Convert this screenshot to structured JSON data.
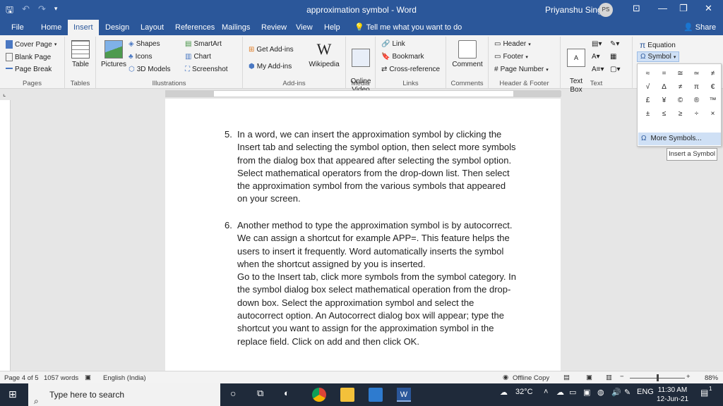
{
  "titlebar": {
    "doc_title": "approximation symbol  -  Word",
    "user_name": "Priyanshu Singh",
    "avatar_initials": "PS"
  },
  "tabs": [
    "File",
    "Home",
    "Insert",
    "Design",
    "Layout",
    "References",
    "Mailings",
    "Review",
    "View",
    "Help"
  ],
  "active_tab": "Insert",
  "tell_me": "Tell me what you want to do",
  "share": "Share",
  "ribbon": {
    "pages": {
      "label": "Pages",
      "cover_page": "Cover Page",
      "blank_page": "Blank Page",
      "page_break": "Page Break"
    },
    "tables": {
      "label": "Tables",
      "table": "Table"
    },
    "illustrations": {
      "label": "Illustrations",
      "pictures": "Pictures",
      "shapes": "Shapes",
      "icons": "Icons",
      "models": "3D Models",
      "smartart": "SmartArt",
      "chart": "Chart",
      "screenshot": "Screenshot"
    },
    "addins": {
      "label": "Add-ins",
      "get": "Get Add-ins",
      "my": "My Add-ins",
      "wikipedia": "Wikipedia"
    },
    "media": {
      "label": "Media",
      "online_video": "Online\nVideo"
    },
    "links": {
      "label": "Links",
      "link": "Link",
      "bookmark": "Bookmark",
      "cross_ref": "Cross-reference"
    },
    "comments": {
      "label": "Comments",
      "comment": "Comment"
    },
    "header_footer": {
      "label": "Header & Footer",
      "header": "Header",
      "footer": "Footer",
      "page_number": "Page Number"
    },
    "text": {
      "label": "Text",
      "text_box": "Text\nBox"
    },
    "symbols": {
      "equation": "Equation",
      "symbol": "Symbol"
    }
  },
  "symbol_panel": {
    "symbols": [
      "≈",
      "=",
      "≅",
      "≃",
      "≠",
      "√",
      "∆",
      "≠",
      "π",
      "€",
      "£",
      "¥",
      "©",
      "®",
      "™",
      "±",
      "≤",
      "≥",
      "÷",
      "×"
    ],
    "more_symbols": "More Symbols...",
    "tooltip": "Insert a Symbol"
  },
  "document": {
    "items": [
      {
        "num": "5.",
        "text": "In a word, we can insert the approximation symbol by clicking the Insert tab and selecting the symbol option, then select more symbols from the dialog box that appeared after selecting the symbol option. Select mathematical operators from the drop-down list. Then select the approximation symbol from the various symbols that appeared on your screen."
      },
      {
        "num": "6.",
        "text": "Another method to type the approximation symbol is by autocorrect. We can assign a shortcut for example APP=. This feature helps the users to insert it frequently. Word automatically inserts the symbol when the shortcut assigned by you is inserted.",
        "text2": "Go to the Insert tab, click more symbols from the symbol category. In the symbol dialog box select mathematical operation from the drop-down box. Select the approximation symbol and select the autocorrect option. An Autocorrect dialog box will appear; type the shortcut you want to assign for the approximation symbol in the replace field. Click on add and then click OK."
      }
    ]
  },
  "statusbar": {
    "page": "Page 4 of 5",
    "words": "1057 words",
    "language": "English (India)",
    "offline": "Offline Copy",
    "zoom": "88%"
  },
  "taskbar": {
    "search_placeholder": "Type here to search",
    "temperature": "32°C",
    "lang": "ENG",
    "time": "11:30 AM",
    "date": "12-Jun-21",
    "notifications": "1"
  }
}
